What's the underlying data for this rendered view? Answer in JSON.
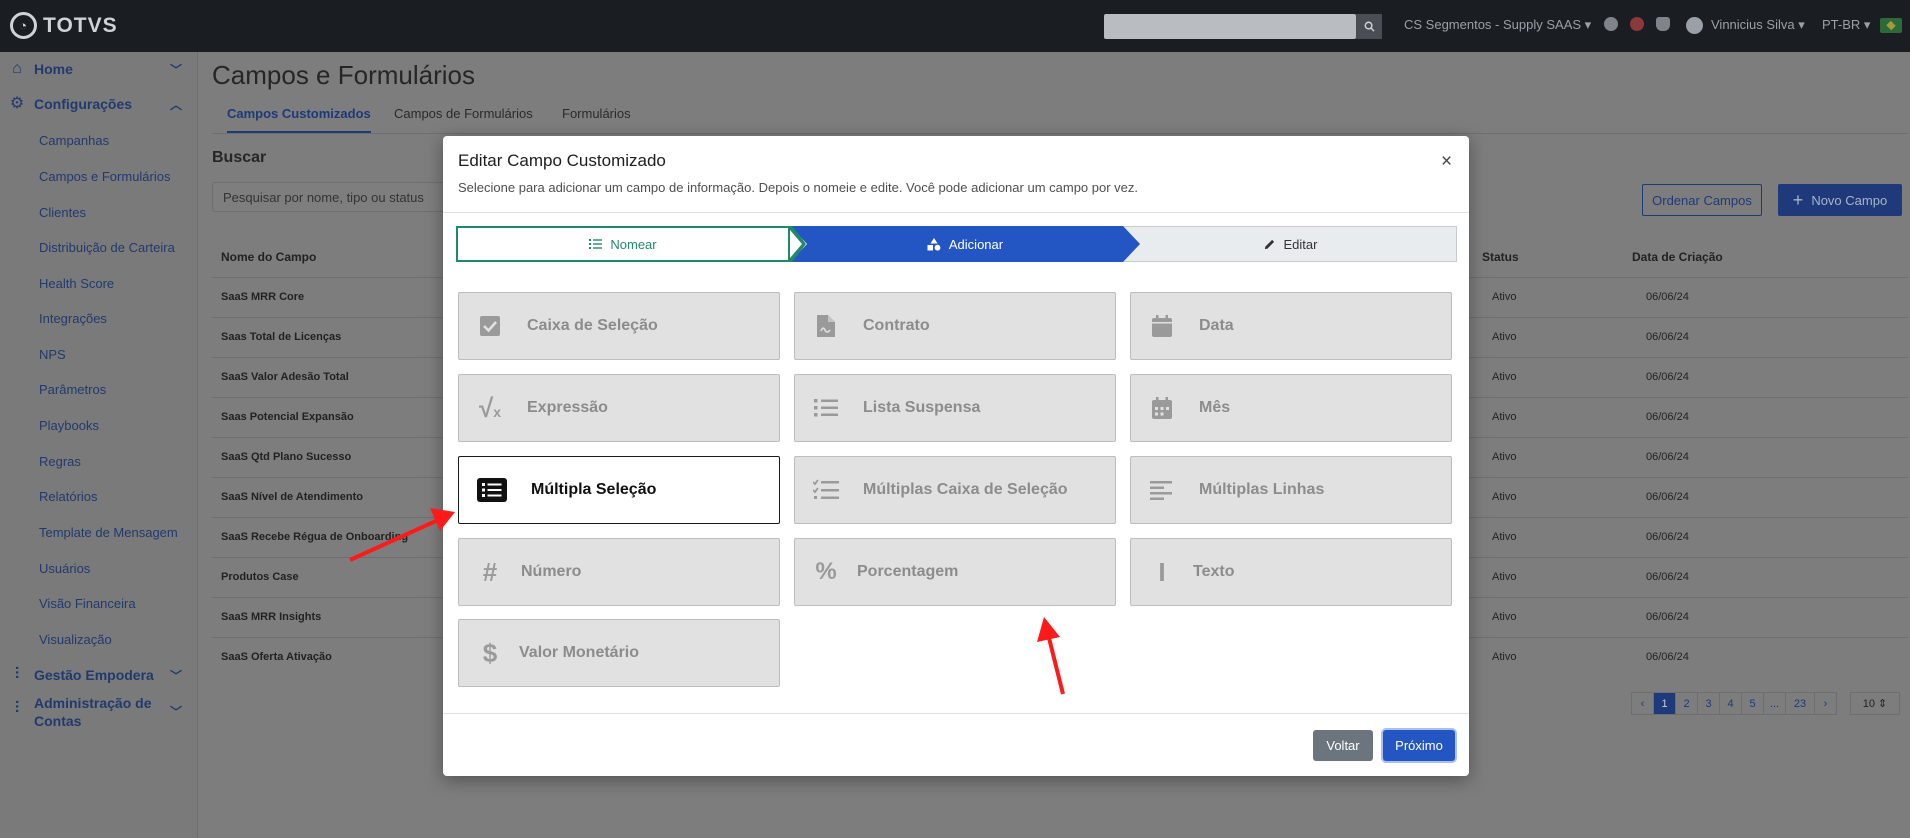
{
  "topbar": {
    "logo_text": "TOTVS",
    "org_name": "CS Segmentos - Supply SAAS",
    "user_name": "Vinnicius Silva",
    "language": "PT-BR"
  },
  "sidebar": {
    "groups": [
      {
        "label": "Home",
        "icon": "home-icon"
      },
      {
        "label": "Configurações",
        "icon": "gear-icon"
      },
      {
        "label": "Gestão Empodera",
        "icon": "sliders-icon"
      },
      {
        "label": "Administração de Contas",
        "icon": "sliders-icon"
      }
    ],
    "items": [
      {
        "label": "Campanhas"
      },
      {
        "label": "Campos e Formulários"
      },
      {
        "label": "Clientes"
      },
      {
        "label": "Distribuição de Carteira"
      },
      {
        "label": "Health Score"
      },
      {
        "label": "Integrações"
      },
      {
        "label": "NPS"
      },
      {
        "label": "Parâmetros"
      },
      {
        "label": "Playbooks"
      },
      {
        "label": "Regras"
      },
      {
        "label": "Relatórios"
      },
      {
        "label": "Template de Mensagem"
      },
      {
        "label": "Usuários"
      },
      {
        "label": "Visão Financeira"
      },
      {
        "label": "Visualização"
      }
    ]
  },
  "main": {
    "title": "Campos e Formulários",
    "tabs": [
      {
        "label": "Campos Customizados"
      },
      {
        "label": "Campos de Formulários"
      },
      {
        "label": "Formulários"
      }
    ],
    "search_label": "Buscar",
    "search_placeholder": "Pesquisar por nome, tipo ou status",
    "btn_ordenar": "Ordenar Campos",
    "btn_novo": "Novo Campo",
    "columns": {
      "name": "Nome do Campo",
      "status": "Status",
      "date": "Data de Criação"
    },
    "rows": [
      {
        "name": "SaaS MRR Core",
        "status": "Ativo",
        "date": "06/06/24"
      },
      {
        "name": "Saas Total de Licenças",
        "status": "Ativo",
        "date": "06/06/24"
      },
      {
        "name": "SaaS Valor Adesão Total",
        "status": "Ativo",
        "date": "06/06/24"
      },
      {
        "name": "Saas Potencial Expansão",
        "status": "Ativo",
        "date": "06/06/24"
      },
      {
        "name": "SaaS Qtd Plano Sucesso",
        "status": "Ativo",
        "date": "06/06/24"
      },
      {
        "name": "SaaS Nível de Atendimento",
        "status": "Ativo",
        "date": "06/06/24"
      },
      {
        "name": "SaaS Recebe Régua de Onboarding",
        "status": "Ativo",
        "date": "06/06/24"
      },
      {
        "name": "Produtos Case",
        "status": "Ativo",
        "date": "06/06/24"
      },
      {
        "name": "SaaS MRR Insights",
        "status": "Ativo",
        "date": "06/06/24"
      },
      {
        "name": "SaaS Oferta Ativação",
        "status": "Ativo",
        "date": "06/06/24"
      }
    ],
    "pager": [
      "‹",
      "1",
      "2",
      "3",
      "4",
      "5",
      "...",
      "23",
      "›"
    ],
    "per_page": "10"
  },
  "modal": {
    "title": "Editar Campo Customizado",
    "subtitle": "Selecione para adicionar um campo de informação. Depois o nomeie e edite. Você pode adicionar um campo por vez.",
    "steps": [
      {
        "label": "Nomear",
        "icon": "list-icon"
      },
      {
        "label": "Adicionar",
        "icon": "shapes-icon"
      },
      {
        "label": "Editar",
        "icon": "pencil-icon"
      }
    ],
    "options": [
      {
        "label": "Caixa de Seleção",
        "icon": "checkbox-icon"
      },
      {
        "label": "Contrato",
        "icon": "contract-file-icon"
      },
      {
        "label": "Data",
        "icon": "calendar-icon"
      },
      {
        "label": "Expressão",
        "icon": "square-root-icon"
      },
      {
        "label": "Lista Suspensa",
        "icon": "list-icon"
      },
      {
        "label": "Mês",
        "icon": "calendar-grid-icon"
      },
      {
        "label": "Múltipla Seleção",
        "icon": "list-box-icon",
        "selected": true
      },
      {
        "label": "Múltiplas Caixa de Seleção",
        "icon": "checklist-icon"
      },
      {
        "label": "Múltiplas Linhas",
        "icon": "align-left-icon"
      },
      {
        "label": "Número",
        "icon": "hashtag-icon"
      },
      {
        "label": "Porcentagem",
        "icon": "percent-icon"
      },
      {
        "label": "Texto",
        "icon": "text-cursor-icon"
      },
      {
        "label": "Valor Monetário",
        "icon": "dollar-icon"
      }
    ],
    "btn_back": "Voltar",
    "btn_next": "Próximo"
  },
  "colors": {
    "primary": "#2356c2",
    "success": "#1f8a6a",
    "secondary": "#6c757d",
    "annotation_arrow": "#ff1a1a"
  }
}
